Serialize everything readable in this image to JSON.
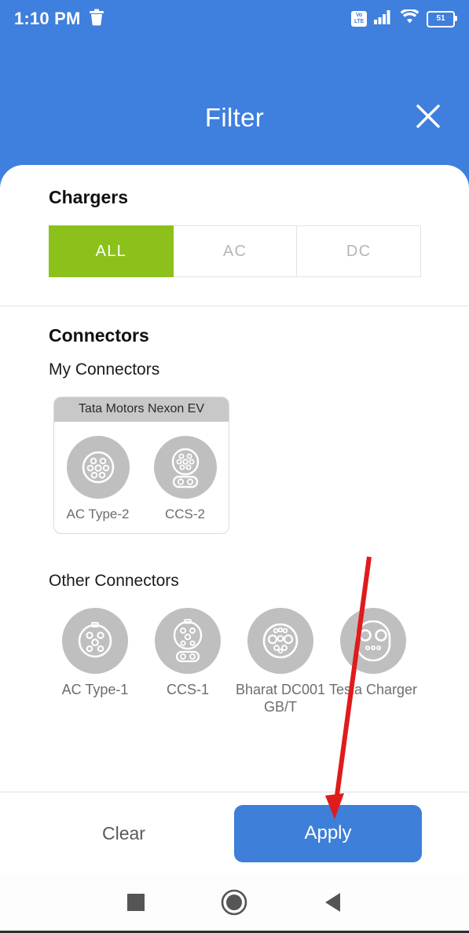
{
  "status_bar": {
    "clock": "1:10 PM",
    "trash_icon": "trash-icon",
    "volte_top": "Vo",
    "volte_bottom": "LTE",
    "signal_icon": "signal-bars-icon",
    "wifi_icon": "wifi-icon",
    "battery_level": "51"
  },
  "header": {
    "title": "Filter",
    "close_icon": "close-icon"
  },
  "chargers": {
    "title": "Chargers",
    "options": [
      {
        "label": "ALL",
        "selected": true
      },
      {
        "label": "AC",
        "selected": false
      },
      {
        "label": "DC",
        "selected": false
      }
    ]
  },
  "connectors": {
    "title": "Connectors",
    "my_connectors_title": "My Connectors",
    "vehicle_card": {
      "name": "Tata Motors Nexon EV",
      "connectors": [
        {
          "label": "AC Type-2",
          "icon": "ac-type-2-icon"
        },
        {
          "label": "CCS-2",
          "icon": "ccs-2-icon"
        }
      ]
    },
    "other_connectors_title": "Other Connectors",
    "other_connectors": [
      {
        "label": "AC Type-1",
        "icon": "ac-type-1-icon"
      },
      {
        "label": "CCS-1",
        "icon": "ccs-1-icon"
      },
      {
        "label": "Bharat DC001 GB/T",
        "icon": "bharat-dc001-icon"
      },
      {
        "label": "Tesla Charger",
        "icon": "tesla-charger-icon"
      }
    ]
  },
  "footer": {
    "clear_label": "Clear",
    "apply_label": "Apply"
  },
  "navbar": {
    "recents_icon": "square-recents-icon",
    "home_icon": "circle-home-icon",
    "back_icon": "triangle-back-icon"
  },
  "annotation": {
    "arrow_color": "#e01b1b",
    "points_to": "apply-button"
  },
  "colors": {
    "brand_blue": "#3f7fdd",
    "accent_green": "#8cc11b",
    "apply_blue": "#3d7fd9",
    "connector_grey": "#bfbfbf"
  }
}
